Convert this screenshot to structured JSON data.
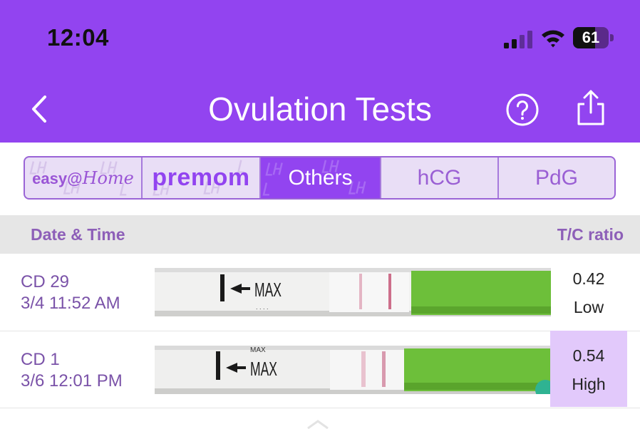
{
  "status_bar": {
    "time": "12:04",
    "battery": "61",
    "battery_level": 0.61
  },
  "nav": {
    "title": "Ovulation Tests",
    "back_icon": "chevron-left-icon",
    "help_icon": "question-circle-icon",
    "share_icon": "share-icon"
  },
  "brand_tabs": {
    "easy_home": {
      "part1": "easy@",
      "part2": "Home"
    },
    "premom": {
      "label": "premom"
    },
    "others": {
      "label": "Others",
      "selected": true
    },
    "hcg": {
      "label": "hCG"
    },
    "pdg": {
      "label": "PdG"
    }
  },
  "list_header": {
    "date_col": "Date & Time",
    "ratio_col": "T/C ratio"
  },
  "rows": [
    {
      "cd": "CD 29",
      "datetime": "3/4 11:52 AM",
      "strip_label": "MAX",
      "ratio": "0.42",
      "level": "Low"
    },
    {
      "cd": "CD 1",
      "datetime": "3/6 12:01 PM",
      "strip_label": "MAX",
      "ratio": "0.54",
      "level": "High"
    }
  ],
  "colors": {
    "header": "#9244f0",
    "high_bg": "#e2c9fb",
    "strip_green": "#6dbf3a",
    "label_purple": "#8d5fb8"
  }
}
